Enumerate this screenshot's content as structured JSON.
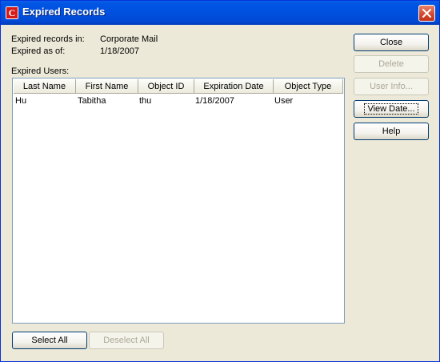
{
  "window": {
    "title": "Expired Records"
  },
  "info": {
    "records_in_label": "Expired records in:",
    "records_in_value": "Corporate Mail",
    "as_of_label": "Expired as of:",
    "as_of_value": "1/18/2007"
  },
  "list": {
    "label": "Expired Users:",
    "columns": [
      "Last Name",
      "First Name",
      "Object ID",
      "Expiration Date",
      "Object Type"
    ],
    "rows": [
      [
        "Hu",
        "Tabitha",
        "thu",
        "1/18/2007",
        "User"
      ]
    ]
  },
  "buttons": {
    "close": "Close",
    "delete": "Delete",
    "user_info": "User Info...",
    "view_date": "View Date...",
    "help": "Help",
    "select_all": "Select All",
    "deselect_all": "Deselect All"
  },
  "colors": {
    "titlebar": "#0054e3",
    "window_bg": "#ece9d8",
    "close_button": "#d3462b",
    "app_icon": "#d61a1a"
  }
}
